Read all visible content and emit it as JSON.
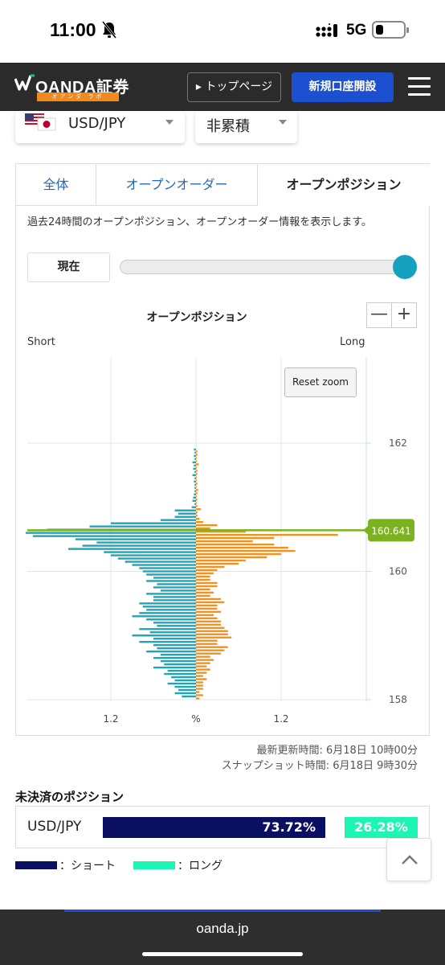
{
  "status_bar": {
    "time": "11:00",
    "network": "5G"
  },
  "header": {
    "brand": "OANDA証券",
    "brand_sub": "オアンダ ラボ",
    "top_page_label": "▸ トップページ",
    "open_account_label": "新規口座開設"
  },
  "selectors": {
    "pair": "USD/JPY",
    "mode": "非累積"
  },
  "tabs": [
    {
      "label": "全体",
      "active": false
    },
    {
      "label": "オープンオーダー",
      "active": false
    },
    {
      "label": "オープンポジション",
      "active": true
    }
  ],
  "description": "過去24時間のオープンポジション、オープンオーダー情報を表示します。",
  "now_button": "現在",
  "slider": {
    "value": 1.0
  },
  "chart_controls": {
    "zoom_out": "—",
    "zoom_in": "+",
    "reset_zoom": "Reset zoom"
  },
  "chart_data": {
    "type": "bar",
    "orientation": "horizontal",
    "title": "オープンポジション",
    "left_label": "Short",
    "right_label": "Long",
    "xlabel": "%",
    "x_tick_labels": [
      "1.2",
      "%",
      "1.2"
    ],
    "xlim": [
      -2.4,
      2.4
    ],
    "ylim": [
      158,
      163
    ],
    "y_ticks": [
      158,
      160,
      162
    ],
    "current_price": 160.641,
    "current_price_label": "160.641",
    "bin_size": 0.05,
    "price_levels": [
      161.9,
      161.85,
      161.8,
      161.75,
      161.7,
      161.65,
      161.6,
      161.55,
      161.5,
      161.45,
      161.4,
      161.35,
      161.3,
      161.25,
      161.2,
      161.15,
      161.1,
      161.05,
      161.0,
      160.95,
      160.9,
      160.85,
      160.8,
      160.75,
      160.7,
      160.65,
      160.6,
      160.55,
      160.5,
      160.45,
      160.4,
      160.35,
      160.3,
      160.25,
      160.2,
      160.15,
      160.1,
      160.05,
      160.0,
      159.95,
      159.9,
      159.85,
      159.8,
      159.75,
      159.7,
      159.65,
      159.6,
      159.55,
      159.5,
      159.45,
      159.4,
      159.35,
      159.3,
      159.25,
      159.2,
      159.15,
      159.1,
      159.05,
      159.0,
      158.95,
      158.9,
      158.85,
      158.8,
      158.75,
      158.7,
      158.65,
      158.6,
      158.55,
      158.5,
      158.45,
      158.4,
      158.35,
      158.3,
      158.25,
      158.2,
      158.15,
      158.1,
      158.05
    ],
    "series": [
      {
        "name": "Short",
        "color": "#1aa7b8",
        "values": [
          0.03,
          0.02,
          0.03,
          0.02,
          0.05,
          0.03,
          0.04,
          0.02,
          0.05,
          0.02,
          0.03,
          0.02,
          0.02,
          0.02,
          0.03,
          0.04,
          0.05,
          0.02,
          0.06,
          0.3,
          0.25,
          0.3,
          0.5,
          1.2,
          1.5,
          2.1,
          2.4,
          2.3,
          1.7,
          1.4,
          1.6,
          1.8,
          1.3,
          1.2,
          1.1,
          1.0,
          0.9,
          0.8,
          0.75,
          0.7,
          0.6,
          0.7,
          0.55,
          0.6,
          0.5,
          0.7,
          0.6,
          0.6,
          0.8,
          0.75,
          0.7,
          0.8,
          0.9,
          0.7,
          0.6,
          0.55,
          0.8,
          0.65,
          0.9,
          0.6,
          0.8,
          0.6,
          0.55,
          0.7,
          0.5,
          0.6,
          0.5,
          0.45,
          0.6,
          0.4,
          0.45,
          0.35,
          0.3,
          0.4,
          0.3,
          0.25,
          0.3,
          0.2
        ]
      },
      {
        "name": "Long",
        "color": "#f0921e",
        "values": [
          0.02,
          0.02,
          0.01,
          0.01,
          0.04,
          0.01,
          0.02,
          0.02,
          0.01,
          0.01,
          0.02,
          0.01,
          0.03,
          0.02,
          0.01,
          0.02,
          0.01,
          0.02,
          0.07,
          0.02,
          0.02,
          0.05,
          0.1,
          0.3,
          0.2,
          0.7,
          2.0,
          1.1,
          0.8,
          1.1,
          1.3,
          1.4,
          1.2,
          1.0,
          0.7,
          0.6,
          0.4,
          0.3,
          0.25,
          0.2,
          0.2,
          0.3,
          0.3,
          0.2,
          0.25,
          0.2,
          0.35,
          0.4,
          0.3,
          0.3,
          0.35,
          0.25,
          0.3,
          0.35,
          0.35,
          0.4,
          0.45,
          0.45,
          0.5,
          0.3,
          0.3,
          0.45,
          0.4,
          0.35,
          0.2,
          0.25,
          0.2,
          0.15,
          0.2,
          0.15,
          0.1,
          0.15,
          0.1,
          0.1,
          0.1,
          0.05,
          0.1,
          0.05
        ]
      }
    ]
  },
  "timestamps": {
    "updated": "最新更新時間: 6月18日 10時00分",
    "snapshot": "スナップショット時間: 6月18日 9時30分"
  },
  "unsettled": {
    "title": "未決済のポジション",
    "pair": "USD/JPY",
    "short_pct": 73.72,
    "long_pct": 26.28,
    "short_label": "73.72%",
    "long_label": "26.28%",
    "short_color": "#0b0f62",
    "long_color": "#1df5b5"
  },
  "legend": {
    "short_label": "：ショート",
    "long_label": "：ロング"
  },
  "browser_url": "oanda.jp"
}
